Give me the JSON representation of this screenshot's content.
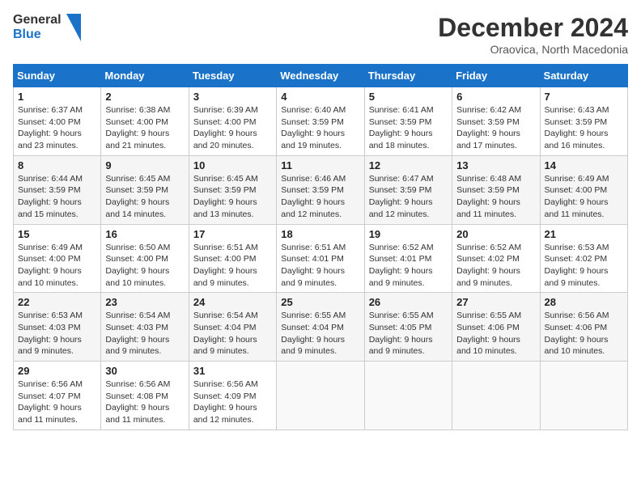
{
  "header": {
    "logo_general": "General",
    "logo_blue": "Blue",
    "month": "December 2024",
    "location": "Oraovica, North Macedonia"
  },
  "weekdays": [
    "Sunday",
    "Monday",
    "Tuesday",
    "Wednesday",
    "Thursday",
    "Friday",
    "Saturday"
  ],
  "weeks": [
    [
      {
        "day": "1",
        "sunrise": "6:37 AM",
        "sunset": "4:00 PM",
        "daylight": "9 hours and 23 minutes."
      },
      {
        "day": "2",
        "sunrise": "6:38 AM",
        "sunset": "4:00 PM",
        "daylight": "9 hours and 21 minutes."
      },
      {
        "day": "3",
        "sunrise": "6:39 AM",
        "sunset": "4:00 PM",
        "daylight": "9 hours and 20 minutes."
      },
      {
        "day": "4",
        "sunrise": "6:40 AM",
        "sunset": "3:59 PM",
        "daylight": "9 hours and 19 minutes."
      },
      {
        "day": "5",
        "sunrise": "6:41 AM",
        "sunset": "3:59 PM",
        "daylight": "9 hours and 18 minutes."
      },
      {
        "day": "6",
        "sunrise": "6:42 AM",
        "sunset": "3:59 PM",
        "daylight": "9 hours and 17 minutes."
      },
      {
        "day": "7",
        "sunrise": "6:43 AM",
        "sunset": "3:59 PM",
        "daylight": "9 hours and 16 minutes."
      }
    ],
    [
      {
        "day": "8",
        "sunrise": "6:44 AM",
        "sunset": "3:59 PM",
        "daylight": "9 hours and 15 minutes."
      },
      {
        "day": "9",
        "sunrise": "6:45 AM",
        "sunset": "3:59 PM",
        "daylight": "9 hours and 14 minutes."
      },
      {
        "day": "10",
        "sunrise": "6:45 AM",
        "sunset": "3:59 PM",
        "daylight": "9 hours and 13 minutes."
      },
      {
        "day": "11",
        "sunrise": "6:46 AM",
        "sunset": "3:59 PM",
        "daylight": "9 hours and 12 minutes."
      },
      {
        "day": "12",
        "sunrise": "6:47 AM",
        "sunset": "3:59 PM",
        "daylight": "9 hours and 12 minutes."
      },
      {
        "day": "13",
        "sunrise": "6:48 AM",
        "sunset": "3:59 PM",
        "daylight": "9 hours and 11 minutes."
      },
      {
        "day": "14",
        "sunrise": "6:49 AM",
        "sunset": "4:00 PM",
        "daylight": "9 hours and 11 minutes."
      }
    ],
    [
      {
        "day": "15",
        "sunrise": "6:49 AM",
        "sunset": "4:00 PM",
        "daylight": "9 hours and 10 minutes."
      },
      {
        "day": "16",
        "sunrise": "6:50 AM",
        "sunset": "4:00 PM",
        "daylight": "9 hours and 10 minutes."
      },
      {
        "day": "17",
        "sunrise": "6:51 AM",
        "sunset": "4:00 PM",
        "daylight": "9 hours and 9 minutes."
      },
      {
        "day": "18",
        "sunrise": "6:51 AM",
        "sunset": "4:01 PM",
        "daylight": "9 hours and 9 minutes."
      },
      {
        "day": "19",
        "sunrise": "6:52 AM",
        "sunset": "4:01 PM",
        "daylight": "9 hours and 9 minutes."
      },
      {
        "day": "20",
        "sunrise": "6:52 AM",
        "sunset": "4:02 PM",
        "daylight": "9 hours and 9 minutes."
      },
      {
        "day": "21",
        "sunrise": "6:53 AM",
        "sunset": "4:02 PM",
        "daylight": "9 hours and 9 minutes."
      }
    ],
    [
      {
        "day": "22",
        "sunrise": "6:53 AM",
        "sunset": "4:03 PM",
        "daylight": "9 hours and 9 minutes."
      },
      {
        "day": "23",
        "sunrise": "6:54 AM",
        "sunset": "4:03 PM",
        "daylight": "9 hours and 9 minutes."
      },
      {
        "day": "24",
        "sunrise": "6:54 AM",
        "sunset": "4:04 PM",
        "daylight": "9 hours and 9 minutes."
      },
      {
        "day": "25",
        "sunrise": "6:55 AM",
        "sunset": "4:04 PM",
        "daylight": "9 hours and 9 minutes."
      },
      {
        "day": "26",
        "sunrise": "6:55 AM",
        "sunset": "4:05 PM",
        "daylight": "9 hours and 9 minutes."
      },
      {
        "day": "27",
        "sunrise": "6:55 AM",
        "sunset": "4:06 PM",
        "daylight": "9 hours and 10 minutes."
      },
      {
        "day": "28",
        "sunrise": "6:56 AM",
        "sunset": "4:06 PM",
        "daylight": "9 hours and 10 minutes."
      }
    ],
    [
      {
        "day": "29",
        "sunrise": "6:56 AM",
        "sunset": "4:07 PM",
        "daylight": "9 hours and 11 minutes."
      },
      {
        "day": "30",
        "sunrise": "6:56 AM",
        "sunset": "4:08 PM",
        "daylight": "9 hours and 11 minutes."
      },
      {
        "day": "31",
        "sunrise": "6:56 AM",
        "sunset": "4:09 PM",
        "daylight": "9 hours and 12 minutes."
      },
      null,
      null,
      null,
      null
    ]
  ]
}
